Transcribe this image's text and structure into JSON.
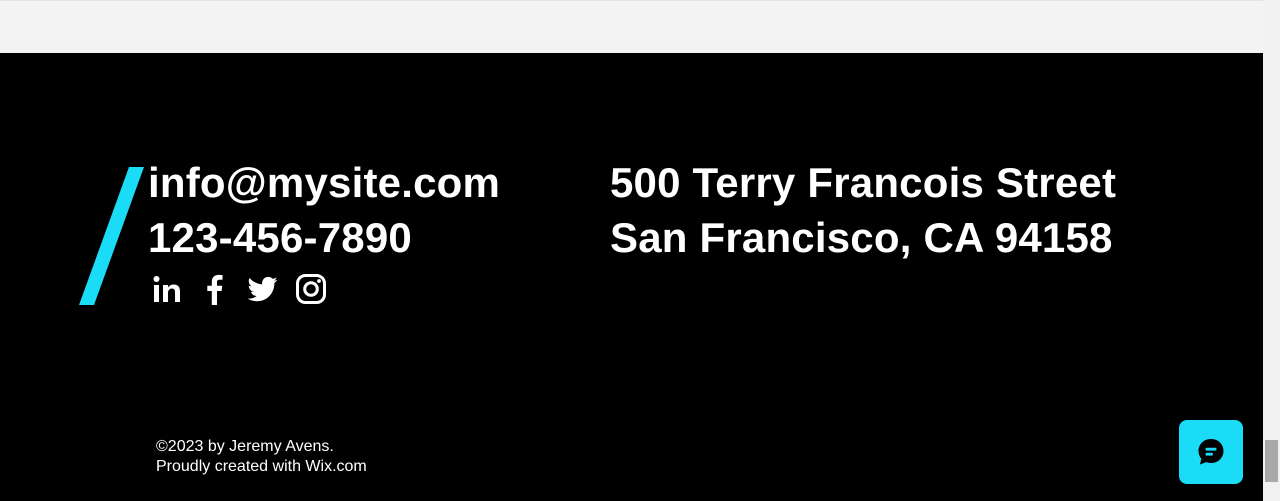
{
  "contact": {
    "email": "info@mysite.com",
    "phone": "123-456-7890"
  },
  "address": {
    "line1": "500 Terry Francois Street",
    "line2": "San Francisco, CA 94158"
  },
  "social": [
    {
      "name": "LinkedIn",
      "icon": "linkedin-icon"
    },
    {
      "name": "Facebook",
      "icon": "facebook-icon"
    },
    {
      "name": "Twitter",
      "icon": "twitter-icon"
    },
    {
      "name": "Instagram",
      "icon": "instagram-icon"
    }
  ],
  "footer": {
    "copyright_line1": "©2023 by Jeremy Avens.",
    "copyright_line2": "Proudly created with Wix.com"
  },
  "chat": {
    "icon": "chat-bubble-icon"
  },
  "colors": {
    "background": "#000000",
    "accent": "#1adcf7",
    "text": "#ffffff",
    "top_strip": "#f3f3f3"
  }
}
